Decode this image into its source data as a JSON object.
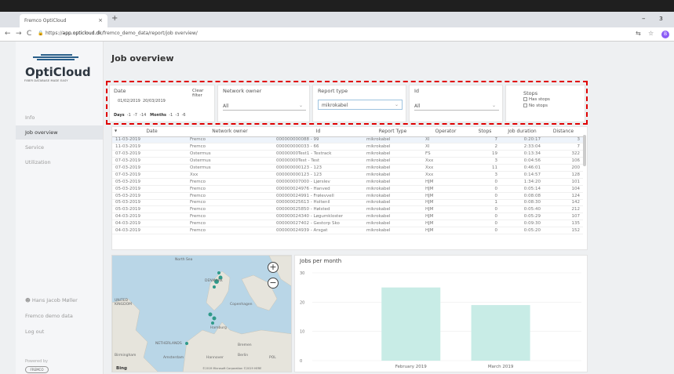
{
  "browser": {
    "tab_title": "Fremco OptiCloud",
    "tab_close": "×",
    "new_tab": "+",
    "url_prefix": "https://",
    "url_host": "app.opticloud.dk",
    "url_path": "/fremco_demo_data/report/job overview/",
    "back": "←",
    "forward": "→",
    "reload": "C",
    "lock": "🔒",
    "translate": "⇆",
    "star": "☆",
    "profile_initial": "B",
    "minimize": "–",
    "maximize": "ɜ"
  },
  "sidebar": {
    "logo_text": "OptiCloud",
    "logo_tagline": "FIBER DATABASE MADE EASY",
    "items": [
      {
        "label": "Info"
      },
      {
        "label": "Job overview"
      },
      {
        "label": "Service"
      },
      {
        "label": "Utilization"
      }
    ],
    "user_name": "Hans Jacob Møller",
    "org": "Fremco demo data",
    "logout": "Log out",
    "powered_by": "Powered by",
    "powered_logo": "FREMCO"
  },
  "page": {
    "title": "Job overview"
  },
  "filters": {
    "date_label": "Date",
    "clear_filter": "Clear filter",
    "date_from": "01/02/2019",
    "date_to": "20/03/2019",
    "days_label": "Days",
    "days_options": [
      "-1",
      "-7",
      "-14"
    ],
    "months_label": "Months",
    "months_options": [
      "-1",
      "-3",
      "-6"
    ],
    "network_owner_label": "Network owner",
    "network_owner_value": "All",
    "report_type_label": "Report type",
    "report_type_value": "mikrokabel",
    "id_label": "Id",
    "id_value": "All",
    "stops_label": "Stops",
    "has_stops": "Has stops",
    "no_stops": "No stops"
  },
  "table": {
    "sort_icon": "▼",
    "columns": [
      "Date",
      "Network owner",
      "Id",
      "Report Type",
      "Operator",
      "Stops",
      "Job duration",
      "Distance"
    ],
    "rows": [
      [
        "11-03-2019",
        "Fremco",
        "000000000088 - 99",
        "mikrokabel",
        "XI",
        "7",
        "0:20:17",
        "3"
      ],
      [
        "11-03-2019",
        "Fremco",
        "000000000033 - 66",
        "mikrokabel",
        "XI",
        "2",
        "2:33:04",
        "7"
      ],
      [
        "07-03-2019",
        "Ostermus",
        "00000000Test1 - Testrack",
        "mikrokabel",
        "FS",
        "19",
        "0:13:34",
        "322"
      ],
      [
        "07-03-2019",
        "Ostermus",
        "00000000Test - Test",
        "mikrokabel",
        "Xxx",
        "3",
        "0:04:56",
        "106"
      ],
      [
        "07-03-2019",
        "Ostermus",
        "000000000123 - 123",
        "mikrokabel",
        "Xxx",
        "11",
        "0:46:01",
        "200"
      ],
      [
        "07-03-2019",
        "Xxx",
        "000000000123 - 123",
        "mikrokabel",
        "Xxx",
        "3",
        "0:14:57",
        "128"
      ],
      [
        "05-03-2019",
        "Fremco",
        "000000007000 - Ljørslev",
        "mikrokabel",
        "HJM",
        "0",
        "1:34:20",
        "101"
      ],
      [
        "05-03-2019",
        "Fremco",
        "000000024976 - Hanved",
        "mikrokabel",
        "HJM",
        "0",
        "0:05:14",
        "104"
      ],
      [
        "05-03-2019",
        "Fremco",
        "000000024991 - Frølevvell",
        "mikrokabel",
        "HJM",
        "0",
        "0:08:08",
        "124"
      ],
      [
        "05-03-2019",
        "Fremco",
        "000000025613 - Holtenil",
        "mikrokabel",
        "HJM",
        "1",
        "0:08:30",
        "142"
      ],
      [
        "05-03-2019",
        "Fremco",
        "000000025850 - Hølsted",
        "mikrokabel",
        "HJM",
        "0",
        "0:05:40",
        "212"
      ],
      [
        "04-03-2019",
        "Fremco",
        "000000024340 - Løgumkloster",
        "mikrokabel",
        "HJM",
        "0",
        "0:05:29",
        "107"
      ],
      [
        "04-03-2019",
        "Fremco",
        "000000027402 - Gestorp Sko",
        "mikrokabel",
        "HJM",
        "0",
        "0:09:30",
        "135"
      ],
      [
        "04-03-2019",
        "Fremco",
        "000000024939 - Arsgat",
        "mikrokabel",
        "HJM",
        "0",
        "0:05:20",
        "152"
      ]
    ]
  },
  "map": {
    "zoom_in": "+",
    "zoom_out": "−",
    "labels": [
      "North Sea",
      "DENMARK",
      "UNITED KINGDOM",
      "Hamburg",
      "NETHERLANDS",
      "Copenhagen",
      "Bremen",
      "Birmingham",
      "Amsterdam",
      "Hannover",
      "Berlin",
      "POL"
    ],
    "attribution": "Bing",
    "copyright": "©2019 Microsoft Corporation  ©2019 HERE"
  },
  "chart_data": {
    "type": "bar",
    "title": "Jobs per month",
    "categories": [
      "February 2019",
      "March 2019"
    ],
    "values": [
      25,
      19
    ],
    "ylim": [
      0,
      30
    ],
    "yticks": [
      0,
      10,
      20,
      30
    ],
    "bar_color": "#c8ece6",
    "grid": true
  }
}
